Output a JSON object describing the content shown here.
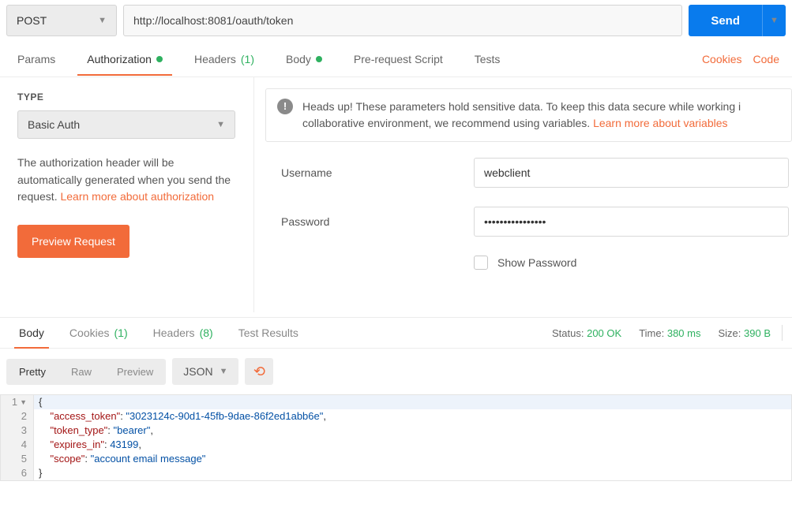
{
  "topbar": {
    "method": "POST",
    "url": "http://localhost:8081/oauth/token",
    "send_label": "Send"
  },
  "req_tabs": {
    "params": "Params",
    "authorization": "Authorization",
    "headers": "Headers",
    "headers_count": "(1)",
    "body": "Body",
    "prereq": "Pre-request Script",
    "tests": "Tests",
    "cookies": "Cookies",
    "code": "Code"
  },
  "auth_pane": {
    "type_label": "TYPE",
    "type_value": "Basic Auth",
    "help_1": "The authorization header will be automatically generated when you send the request. ",
    "help_link": "Learn more about authorization",
    "preview_btn": "Preview Request"
  },
  "notice": {
    "text_1": "Heads up! These parameters hold sensitive data. To keep this data secure while working i",
    "text_2": "collaborative environment, we recommend using variables. ",
    "link": "Learn more about variables"
  },
  "form": {
    "username_label": "Username",
    "username_value": "webclient",
    "password_label": "Password",
    "password_value": "••••••••••••••••",
    "show_pw_label": "Show Password"
  },
  "resp_tabs": {
    "body": "Body",
    "cookies": "Cookies",
    "cookies_count": "(1)",
    "headers": "Headers",
    "headers_count": "(8)",
    "test_results": "Test Results"
  },
  "status": {
    "status_label": "Status:",
    "status_value": "200 OK",
    "time_label": "Time:",
    "time_value": "380 ms",
    "size_label": "Size:",
    "size_value": "390 B"
  },
  "view": {
    "pretty": "Pretty",
    "raw": "Raw",
    "preview": "Preview",
    "format": "JSON"
  },
  "response_json": {
    "access_token": "3023124c-90d1-45fb-9dae-86f2ed1abb6e",
    "token_type": "bearer",
    "expires_in": 43199,
    "scope": "account email message"
  },
  "code_lines": {
    "l1": "{",
    "l2_k": "\"access_token\"",
    "l2_v": "\"3023124c-90d1-45fb-9dae-86f2ed1abb6e\"",
    "l3_k": "\"token_type\"",
    "l3_v": "\"bearer\"",
    "l4_k": "\"expires_in\"",
    "l4_v": "43199",
    "l5_k": "\"scope\"",
    "l5_v": "\"account email message\"",
    "l6": "}"
  }
}
